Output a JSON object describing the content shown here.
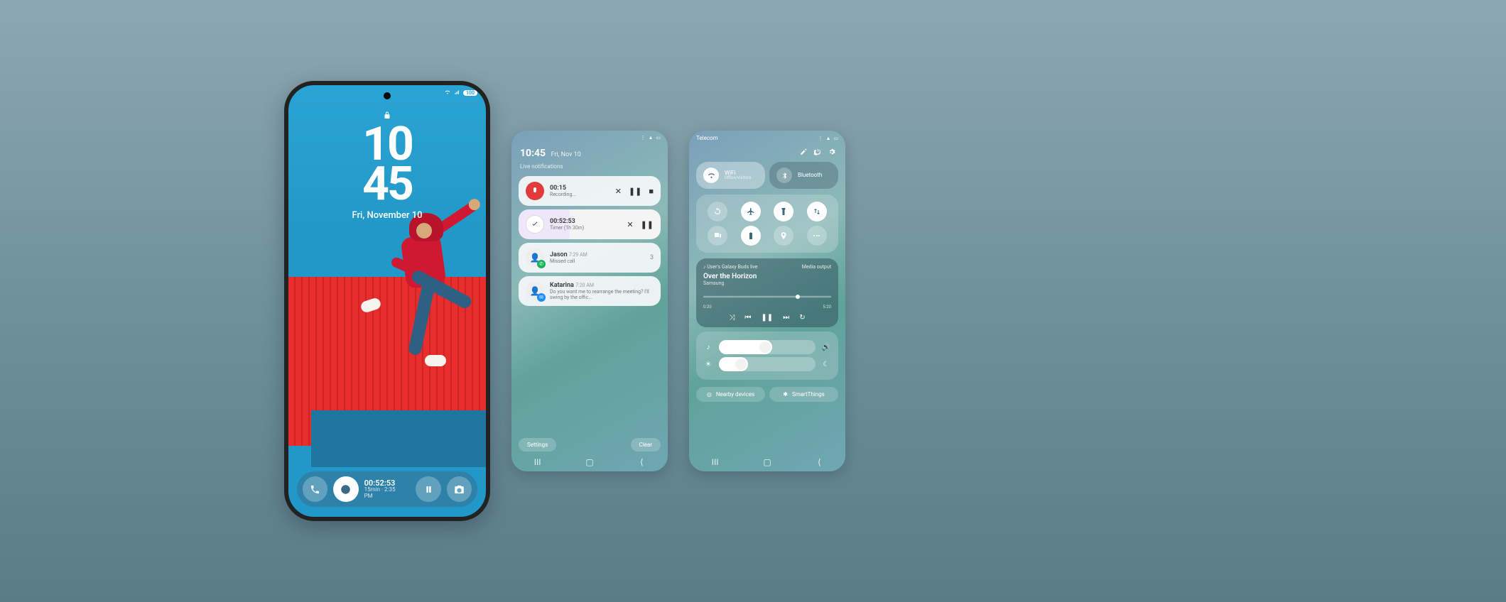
{
  "statusbar": {
    "battery": "100"
  },
  "lockscreen": {
    "hour": "10",
    "minute": "45",
    "date": "Fri, November 10",
    "widget_time": "00:52:53",
    "widget_sub": "15min · 2:35 PM"
  },
  "notifications": {
    "time": "10:45",
    "date": "Fri, Nov 10",
    "section": "Live notifications",
    "recording": {
      "time": "00:15",
      "label": "Recording..."
    },
    "timer": {
      "time": "00:52:53",
      "label": "Timer (1h 30m)"
    },
    "n1": {
      "name": "Jason",
      "ts": "7:29 AM",
      "sub": "Missed call",
      "count": "3"
    },
    "n2": {
      "name": "Katarina",
      "ts": "7:20 AM",
      "sub": "Do you want me to rearrange the meeting? I'll swing by the offic..."
    },
    "settings": "Settings",
    "clear": "Clear"
  },
  "quicksettings": {
    "carrier": "Telecom",
    "wifi": {
      "label": "WiFi",
      "sub": "Office/visitors"
    },
    "bluetooth": {
      "label": "Bluetooth"
    },
    "media": {
      "device": "User's Galaxy Buds live",
      "output": "Media output",
      "song": "Over the Horizon",
      "artist": "Samsung",
      "elapsed": "0:20",
      "total": "5:20"
    },
    "volume_pct": 55,
    "brightness_pct": 30,
    "nearby": "Nearby devices",
    "smartthings": "SmartThings"
  }
}
